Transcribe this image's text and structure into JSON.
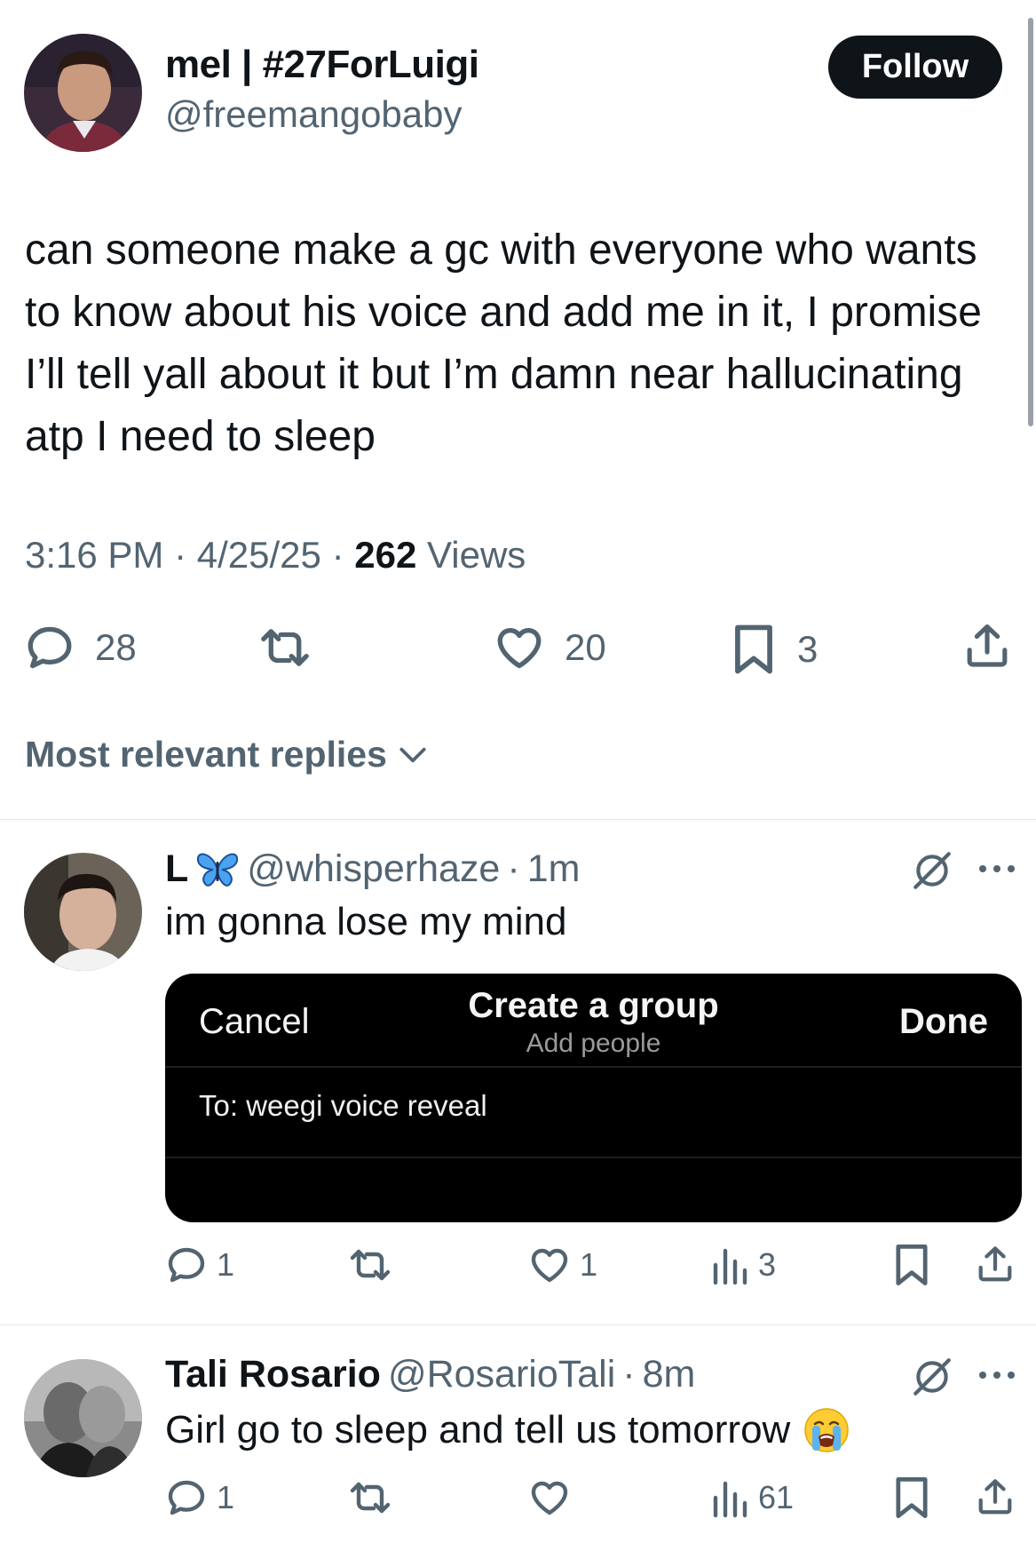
{
  "main_tweet": {
    "display_name": "mel | #27ForLuigi",
    "handle": "@freemangobaby",
    "follow_label": "Follow",
    "text": "can someone make a gc with everyone who wants to know about his voice and add me in it, I promise I’ll tell yall about it but I’m damn near hallucinating atp I need to sleep",
    "time": "3:16 PM",
    "date": "4/25/25",
    "views_count": "262",
    "views_label": "Views",
    "separator": "·",
    "actions": {
      "replies": "28",
      "retweets": "",
      "likes": "20",
      "bookmarks": "3"
    }
  },
  "replies_sort": {
    "label": "Most relevant replies",
    "icon": "chevron-down-icon"
  },
  "replies": [
    {
      "display_name": "L",
      "name_emoji": "butterfly",
      "handle": "@whisperhaze",
      "age": "1m",
      "text": "im gonna lose my mind",
      "embed": {
        "cancel_label": "Cancel",
        "title": "Create a group",
        "subtitle": "Add people",
        "done_label": "Done",
        "to_text": "To: weegi voice reveal"
      },
      "actions": {
        "replies": "1",
        "likes": "1",
        "views": "3"
      }
    },
    {
      "display_name": "Tali Rosario",
      "handle": "@RosarioTali",
      "age": "8m",
      "text": "Girl go to sleep and tell us tomorrow",
      "emoji": "loudly-crying-face",
      "actions": {
        "replies": "1",
        "likes": "",
        "views": "61"
      }
    }
  ],
  "colors": {
    "text_primary": "#0f1419",
    "text_secondary": "#536471",
    "follow_bg": "#0f1419",
    "divider": "#e4e8eb",
    "embed_bg": "#000000"
  }
}
